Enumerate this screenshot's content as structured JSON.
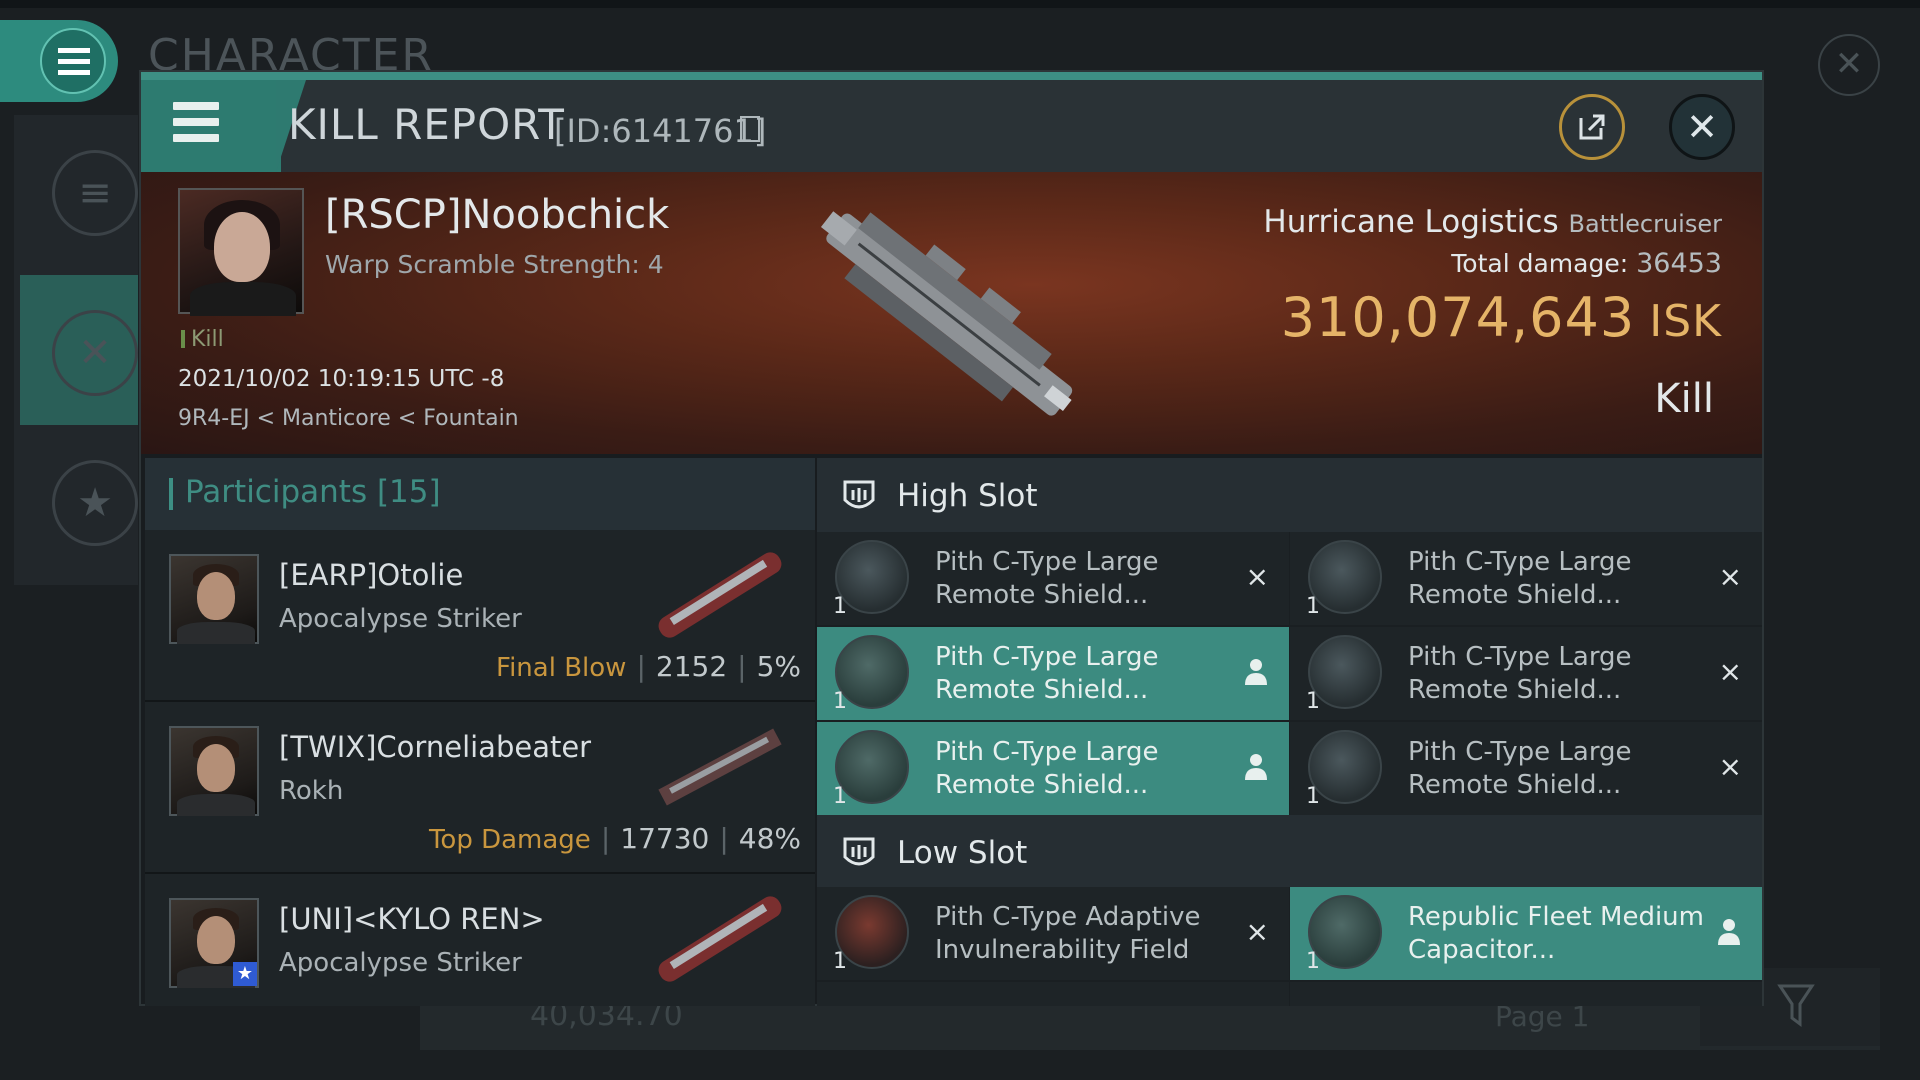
{
  "background": {
    "title": "CHARACTER",
    "strip_value": "40,034.70",
    "page": "Page 1"
  },
  "dialog": {
    "title": "KILL REPORT",
    "id_label": "[ID:6141761]",
    "victim": {
      "name": "[RSCP]Noobchick",
      "warp_scramble": "Warp Scramble Strength: 4",
      "tag": "Kill",
      "datetime": "2021/10/02 10:19:15 UTC -8",
      "location": "9R4-EJ < Manticore < Fountain"
    },
    "ship": {
      "name": "Hurricane Logistics",
      "class": "Battlecruiser",
      "total_damage_label": "Total damage:",
      "total_damage": "36453",
      "isk_value": "310,074,643",
      "isk_unit": "ISK",
      "result": "Kill"
    },
    "participants": {
      "header": "Participants [15]",
      "rows": [
        {
          "name": "[EARP]Otolie",
          "ship": "Apocalypse Striker",
          "label": "Final Blow",
          "damage": "2152",
          "percent": "5%"
        },
        {
          "name": "[TWIX]Corneliabeater",
          "ship": "Rokh",
          "label": "Top Damage",
          "damage": "17730",
          "percent": "48%"
        },
        {
          "name": "[UNI]<KYLO REN>",
          "ship": "Apocalypse Striker",
          "label": "",
          "damage": "",
          "percent": ""
        }
      ]
    },
    "high_slot": {
      "label": "High Slot",
      "modules": [
        {
          "name": "Pith C-Type Large Remote Shield...",
          "qty": "1",
          "state": "destroyed"
        },
        {
          "name": "Pith C-Type Large Remote Shield...",
          "qty": "1",
          "state": "destroyed"
        },
        {
          "name": "Pith C-Type Large Remote Shield...",
          "qty": "1",
          "state": "dropped"
        },
        {
          "name": "Pith C-Type Large Remote Shield...",
          "qty": "1",
          "state": "destroyed"
        },
        {
          "name": "Pith C-Type Large Remote Shield...",
          "qty": "1",
          "state": "dropped"
        },
        {
          "name": "Pith C-Type Large Remote Shield...",
          "qty": "1",
          "state": "destroyed"
        }
      ]
    },
    "low_slot": {
      "label": "Low Slot",
      "modules": [
        {
          "name": "Pith C-Type Adaptive Invulnerability Field",
          "qty": "1",
          "state": "destroyed"
        },
        {
          "name": "Republic Fleet Medium Capacitor...",
          "qty": "1",
          "state": "dropped"
        }
      ]
    }
  },
  "icons": {
    "destroyed": "×",
    "dropped": "person-icon"
  },
  "colors": {
    "accent": "#3c8b80",
    "isk": "#e5b468",
    "label_gold": "#c9963e"
  }
}
